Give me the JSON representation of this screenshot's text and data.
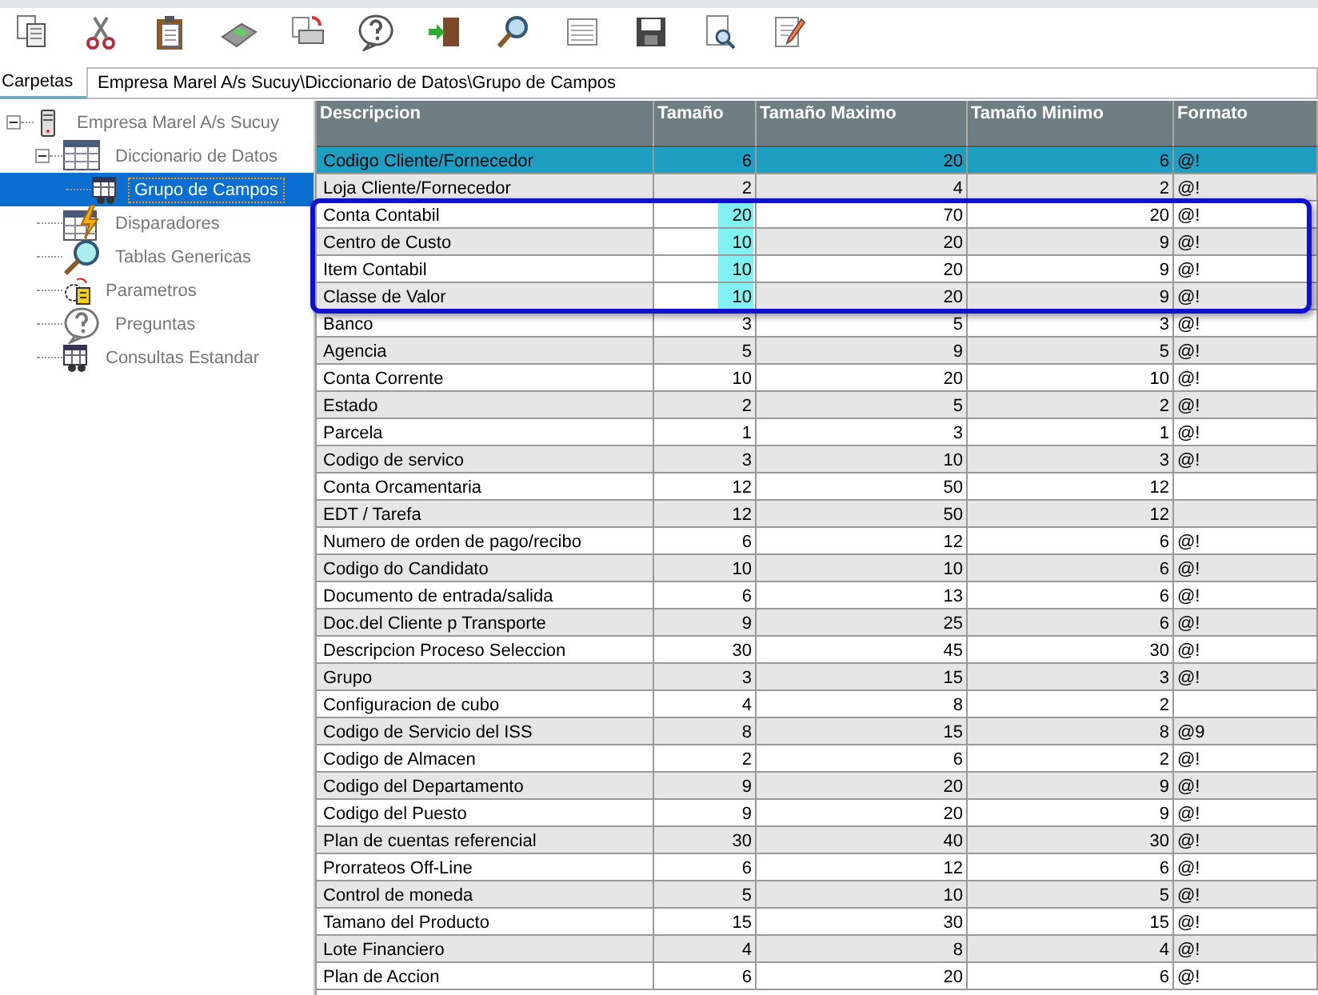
{
  "folders_tab": {
    "label": "Carpetas",
    "selected": true
  },
  "path": "Empresa Marel A/s Sucuy\\Diccionario de Datos\\Grupo de Campos",
  "tree": [
    {
      "label": "Empresa Marel A/s Sucuy",
      "selected": false,
      "expanded": true,
      "children": [
        {
          "label": "Diccionario de Datos",
          "selected": false,
          "expanded": true,
          "children": [
            {
              "label": "Grupo de Campos",
              "selected": true
            }
          ]
        },
        {
          "label": "Disparadores",
          "selected": false
        },
        {
          "label": "Tablas Genericas",
          "selected": false
        },
        {
          "label": "Parametros",
          "selected": false
        },
        {
          "label": "Preguntas",
          "selected": false
        },
        {
          "label": "Consultas Estandar",
          "selected": false
        }
      ]
    }
  ],
  "table": {
    "columns": [
      "Descripcion",
      "Tamaño",
      "Tamaño Maximo",
      "Tamaño Minimo",
      "Formato"
    ],
    "rows": [
      {
        "cells": [
          "Codigo Cliente/Fornecedor",
          "6",
          "20",
          "6",
          "@!"
        ],
        "selected": true,
        "highlighted": false
      },
      {
        "cells": [
          "Loja Cliente/Fornecedor",
          "2",
          "4",
          "2",
          "@!"
        ],
        "selected": false,
        "highlighted": false
      },
      {
        "cells": [
          "Conta Contabil",
          "20",
          "70",
          "20",
          "@!"
        ],
        "selected": false,
        "highlighted": true
      },
      {
        "cells": [
          "Centro de Custo",
          "10",
          "20",
          "9",
          "@!"
        ],
        "selected": false,
        "highlighted": true
      },
      {
        "cells": [
          "Item Contabil",
          "10",
          "20",
          "9",
          "@!"
        ],
        "selected": false,
        "highlighted": true
      },
      {
        "cells": [
          "Classe de Valor",
          "10",
          "20",
          "9",
          "@!"
        ],
        "selected": false,
        "highlighted": true
      },
      {
        "cells": [
          "Banco",
          "3",
          "5",
          "3",
          "@!"
        ],
        "selected": false,
        "highlighted": false
      },
      {
        "cells": [
          "Agencia",
          "5",
          "9",
          "5",
          "@!"
        ],
        "selected": false,
        "highlighted": false
      },
      {
        "cells": [
          "Conta Corrente",
          "10",
          "20",
          "10",
          "@!"
        ],
        "selected": false,
        "highlighted": false
      },
      {
        "cells": [
          "Estado",
          "2",
          "5",
          "2",
          "@!"
        ],
        "selected": false,
        "highlighted": false
      },
      {
        "cells": [
          "Parcela",
          "1",
          "3",
          "1",
          "@!"
        ],
        "selected": false,
        "highlighted": false
      },
      {
        "cells": [
          "Codigo de servico",
          "3",
          "10",
          "3",
          "@!"
        ],
        "selected": false,
        "highlighted": false
      },
      {
        "cells": [
          "Conta Orcamentaria",
          "12",
          "50",
          "12",
          ""
        ],
        "selected": false,
        "highlighted": false
      },
      {
        "cells": [
          "EDT / Tarefa",
          "12",
          "50",
          "12",
          ""
        ],
        "selected": false,
        "highlighted": false
      },
      {
        "cells": [
          "Numero de orden de pago/recibo",
          "6",
          "12",
          "6",
          "@!"
        ],
        "selected": false,
        "highlighted": false
      },
      {
        "cells": [
          "Codigo do Candidato",
          "10",
          "10",
          "6",
          "@!"
        ],
        "selected": false,
        "highlighted": false
      },
      {
        "cells": [
          "Documento de entrada/salida",
          "6",
          "13",
          "6",
          "@!"
        ],
        "selected": false,
        "highlighted": false
      },
      {
        "cells": [
          "Doc.del Cliente p Transporte",
          "9",
          "25",
          "6",
          "@!"
        ],
        "selected": false,
        "highlighted": false
      },
      {
        "cells": [
          "Descripcion Proceso Seleccion",
          "30",
          "45",
          "30",
          "@!"
        ],
        "selected": false,
        "highlighted": false
      },
      {
        "cells": [
          "Grupo",
          "3",
          "15",
          "3",
          "@!"
        ],
        "selected": false,
        "highlighted": false
      },
      {
        "cells": [
          "Configuracion de cubo",
          "4",
          "8",
          "2",
          ""
        ],
        "selected": false,
        "highlighted": false
      },
      {
        "cells": [
          "Codigo de Servicio del ISS",
          "8",
          "15",
          "8",
          "@9"
        ],
        "selected": false,
        "highlighted": false
      },
      {
        "cells": [
          "Codigo de Almacen",
          "2",
          "6",
          "2",
          "@!"
        ],
        "selected": false,
        "highlighted": false
      },
      {
        "cells": [
          "Codigo del Departamento",
          "9",
          "20",
          "9",
          "@!"
        ],
        "selected": false,
        "highlighted": false
      },
      {
        "cells": [
          "Codigo del Puesto",
          "9",
          "20",
          "9",
          "@!"
        ],
        "selected": false,
        "highlighted": false
      },
      {
        "cells": [
          "Plan de cuentas referencial",
          "30",
          "40",
          "30",
          "@!"
        ],
        "selected": false,
        "highlighted": false
      },
      {
        "cells": [
          "Prorrateos Off-Line",
          "6",
          "12",
          "6",
          "@!"
        ],
        "selected": false,
        "highlighted": false
      },
      {
        "cells": [
          "Control de moneda",
          "5",
          "10",
          "5",
          "@!"
        ],
        "selected": false,
        "highlighted": false
      },
      {
        "cells": [
          "Tamano del Producto",
          "15",
          "30",
          "15",
          "@!"
        ],
        "selected": false,
        "highlighted": false
      },
      {
        "cells": [
          "Lote Financiero",
          "4",
          "8",
          "4",
          "@!"
        ],
        "selected": false,
        "highlighted": false
      },
      {
        "cells": [
          "Plan de Accion",
          "6",
          "20",
          "6",
          "@!"
        ],
        "selected": false,
        "highlighted": false
      }
    ]
  }
}
